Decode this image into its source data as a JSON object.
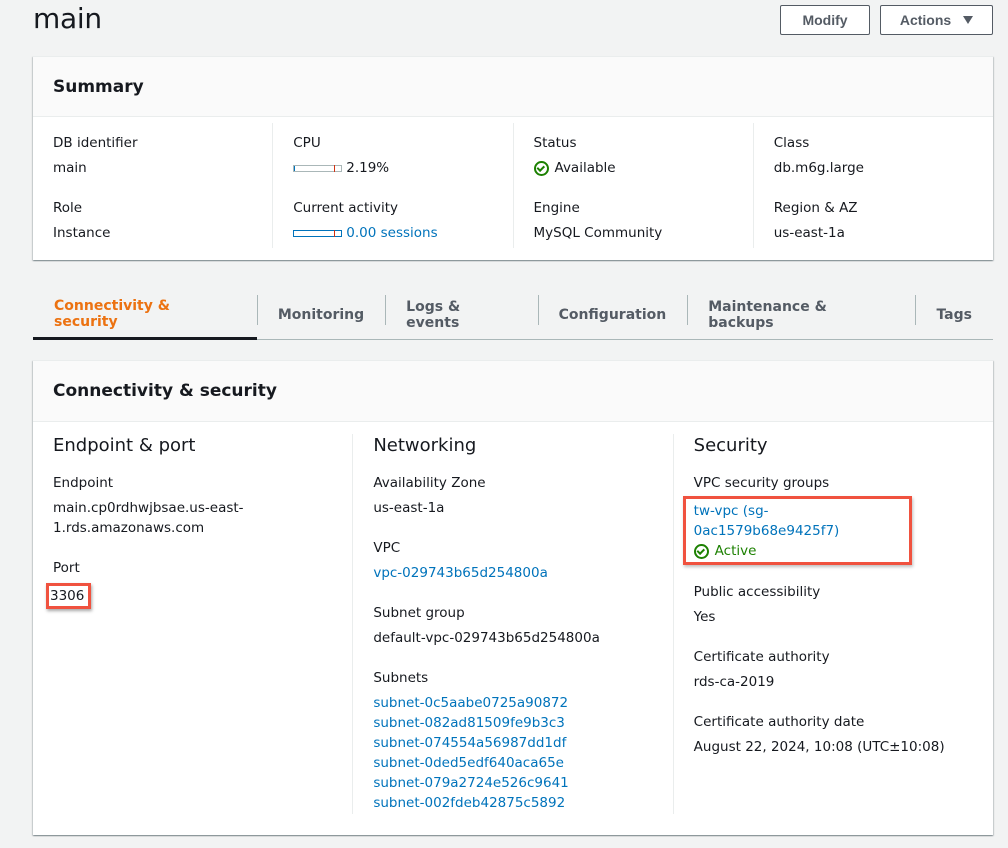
{
  "page": {
    "title": "main"
  },
  "toolbar": {
    "modify_label": "Modify",
    "actions_label": "Actions"
  },
  "summary": {
    "title": "Summary",
    "db_identifier": {
      "label": "DB identifier",
      "value": "main"
    },
    "role": {
      "label": "Role",
      "value": "Instance"
    },
    "cpu": {
      "label": "CPU",
      "value": "2.19%",
      "percent": 2.19
    },
    "current_activity": {
      "label": "Current activity",
      "value": "0.00 sessions",
      "sessions": 0.0
    },
    "status": {
      "label": "Status",
      "value": "Available",
      "color": "#1d8102"
    },
    "engine": {
      "label": "Engine",
      "value": "MySQL Community"
    },
    "class": {
      "label": "Class",
      "value": "db.m6g.large"
    },
    "region": {
      "label": "Region & AZ",
      "value": "us-east-1a"
    }
  },
  "tabs": [
    {
      "label": "Connectivity & security",
      "active": true
    },
    {
      "label": "Monitoring",
      "active": false
    },
    {
      "label": "Logs & events",
      "active": false
    },
    {
      "label": "Configuration",
      "active": false
    },
    {
      "label": "Maintenance & backups",
      "active": false
    },
    {
      "label": "Tags",
      "active": false
    }
  ],
  "connectivity": {
    "title": "Connectivity & security",
    "endpoint_port": {
      "heading": "Endpoint & port",
      "endpoint": {
        "label": "Endpoint",
        "value_line1": "main.cp0rdhwjbsae.us-east-",
        "value_line2": "1.rds.amazonaws.com"
      },
      "port": {
        "label": "Port",
        "value": "3306"
      }
    },
    "networking": {
      "heading": "Networking",
      "availability_zone": {
        "label": "Availability Zone",
        "value": "us-east-1a"
      },
      "vpc": {
        "label": "VPC",
        "value": "vpc-029743b65d254800a"
      },
      "subnet_group": {
        "label": "Subnet group",
        "value": "default-vpc-029743b65d254800a"
      },
      "subnets": {
        "label": "Subnets",
        "items": [
          "subnet-0c5aabe0725a90872",
          "subnet-082ad81509fe9b3c3",
          "subnet-074554a56987dd1df",
          "subnet-0ded5edf640aca65e",
          "subnet-079a2724e526c9641",
          "subnet-002fdeb42875c5892"
        ]
      }
    },
    "security": {
      "heading": "Security",
      "vpc_security_groups": {
        "label": "VPC security groups",
        "value": "tw-vpc (sg-0ac1579b68e9425f7)",
        "status": "Active"
      },
      "public_accessibility": {
        "label": "Public accessibility",
        "value": "Yes"
      },
      "certificate_authority": {
        "label": "Certificate authority",
        "value": "rds-ca-2019"
      },
      "certificate_authority_date": {
        "label": "Certificate authority date",
        "value": "August 22, 2024, 10:08 (UTC±10:08)"
      }
    }
  },
  "colors": {
    "accent_tab": "#ec7211",
    "link": "#0073bb",
    "success": "#1d8102",
    "highlight": "#f0523f"
  }
}
